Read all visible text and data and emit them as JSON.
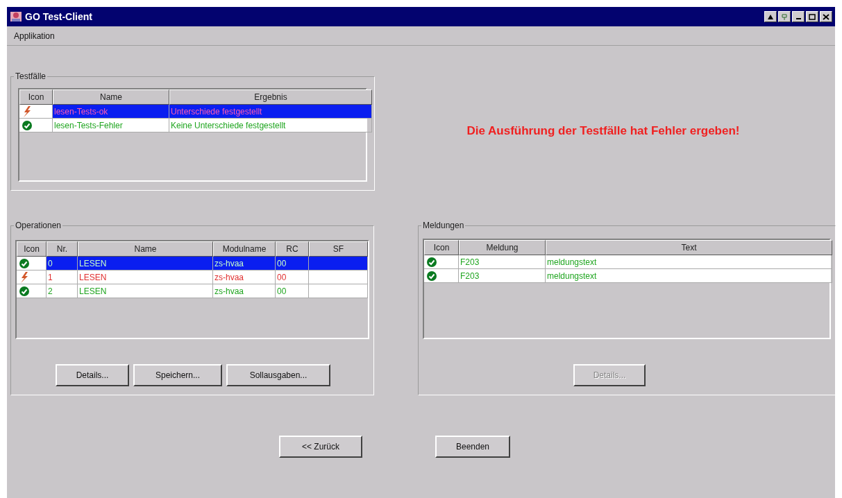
{
  "window": {
    "title": "GO Test-Client"
  },
  "menu": [
    {
      "label": "Applikation"
    }
  ],
  "testfaelle": {
    "title": "Testfälle",
    "columns": [
      "Icon",
      "Name",
      "Ergebnis"
    ],
    "rows": [
      {
        "kind": "error",
        "selected": true,
        "cells": [
          "",
          "lesen-Tests-ok",
          "Unterschiede festgestellt"
        ]
      },
      {
        "kind": "ok",
        "selected": false,
        "cells": [
          "",
          "lesen-Tests-Fehler",
          "Keine Unterschiede festgestellt"
        ]
      }
    ]
  },
  "message": "Die Ausführung der Testfälle hat Fehler ergeben!",
  "operationen": {
    "title": "Operationen",
    "columns": [
      "Icon",
      "Nr.",
      "Name",
      "Modulname",
      "RC",
      "SF"
    ],
    "rows": [
      {
        "kind": "ok",
        "selected": true,
        "cells": [
          "",
          "0",
          "LESEN",
          "zs-hvaa",
          "00",
          ""
        ]
      },
      {
        "kind": "error",
        "selected": false,
        "cells": [
          "",
          "1",
          "LESEN",
          "zs-hvaa",
          "00",
          ""
        ]
      },
      {
        "kind": "ok",
        "selected": false,
        "cells": [
          "",
          "2",
          "LESEN",
          "zs-hvaa",
          "00",
          ""
        ]
      }
    ],
    "buttons": [
      {
        "label": "Details...",
        "disabled": false
      },
      {
        "label": "Speichern...",
        "disabled": false
      },
      {
        "label": "Sollausgaben...",
        "disabled": false
      }
    ]
  },
  "meldungen": {
    "title": "Meldungen",
    "columns": [
      "Icon",
      "Meldung",
      "Text"
    ],
    "rows": [
      {
        "kind": "ok",
        "selected": false,
        "cells": [
          "",
          "F203",
          "meldungstext"
        ]
      },
      {
        "kind": "ok",
        "selected": false,
        "cells": [
          "",
          "F203",
          "meldungstext"
        ]
      }
    ],
    "buttons": [
      {
        "label": "Details...",
        "disabled": true
      }
    ]
  },
  "footer_buttons": [
    {
      "label": "<< Zurück",
      "disabled": false
    },
    {
      "label": "Beenden",
      "disabled": false
    }
  ]
}
